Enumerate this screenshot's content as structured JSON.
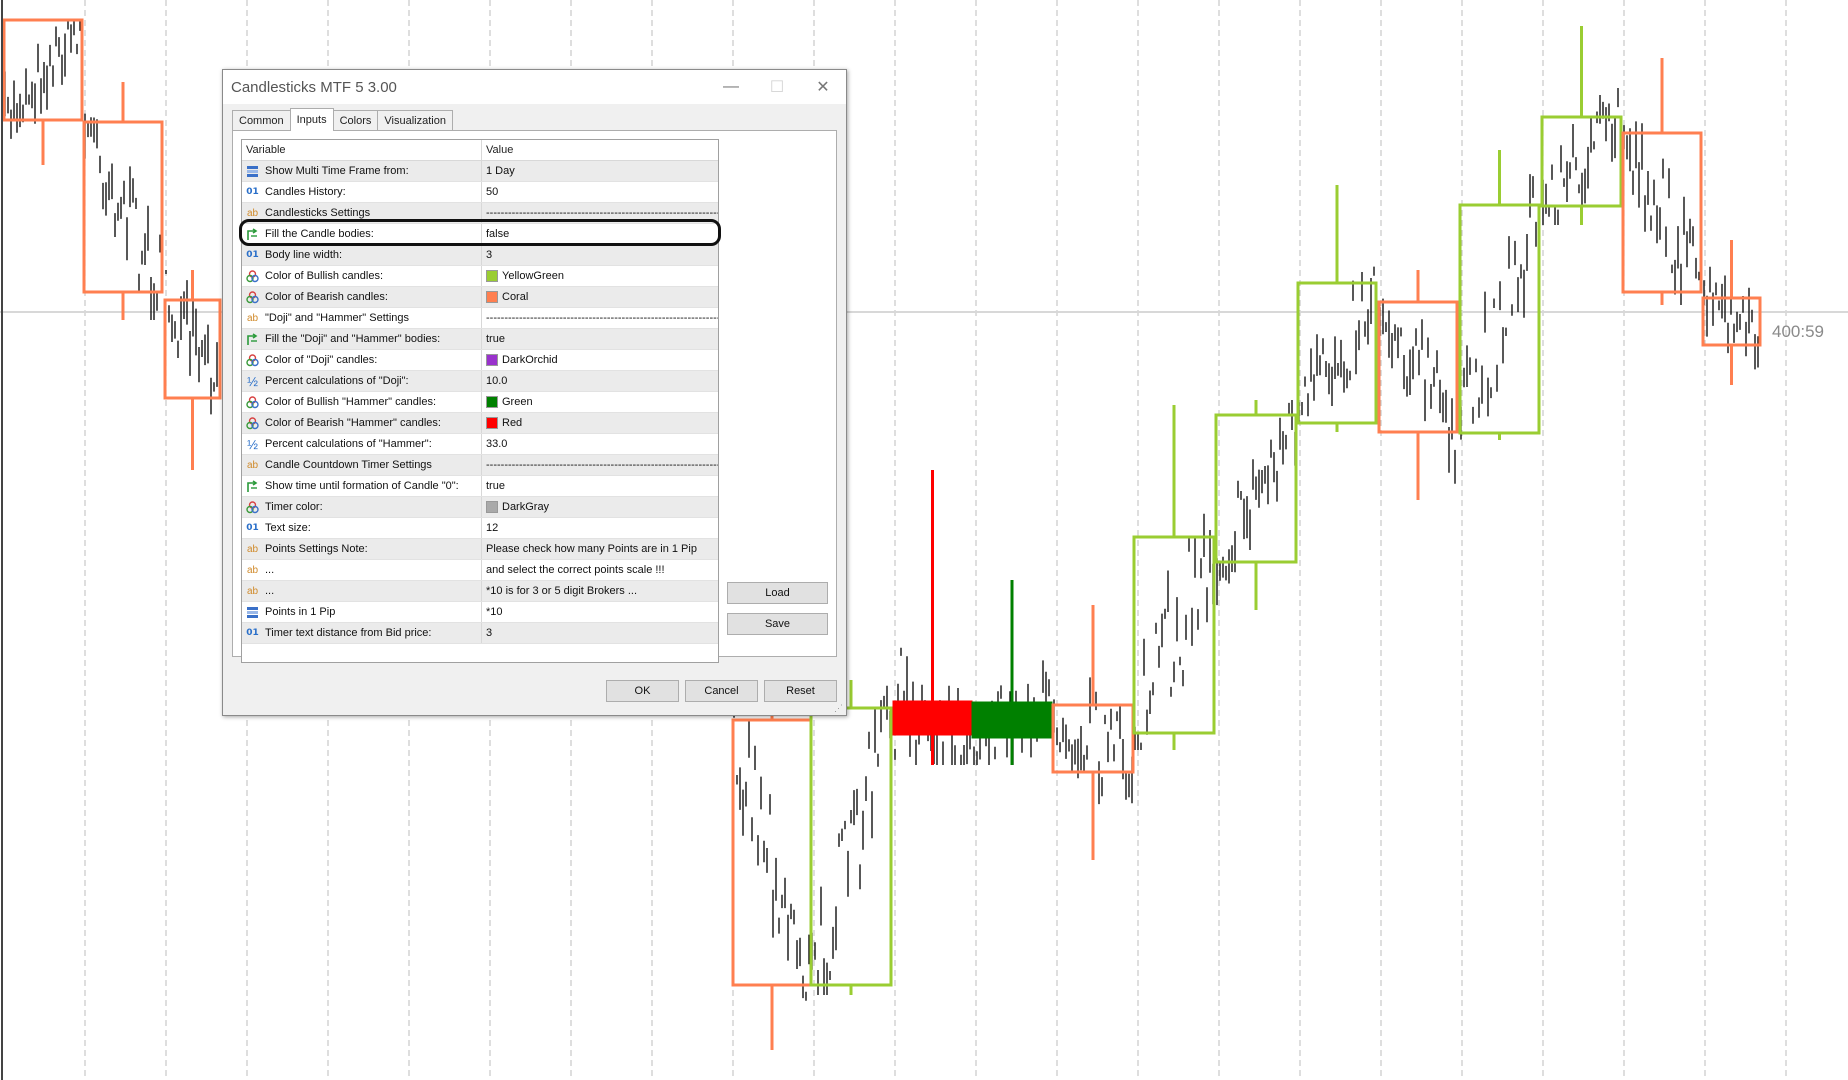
{
  "dialog": {
    "title": "Candlesticks MTF 5 3.00",
    "window_buttons": {
      "minimize": "—",
      "maximize": "☐",
      "close": "✕"
    },
    "tabs": [
      {
        "label": "Common",
        "active": false
      },
      {
        "label": "Inputs",
        "active": true
      },
      {
        "label": "Colors",
        "active": false
      },
      {
        "label": "Visualization",
        "active": false
      }
    ],
    "columns": {
      "variable": "Variable",
      "value": "Value"
    },
    "rows": [
      {
        "icon": "enum",
        "variable": "Show Multi Time Frame from:",
        "value": "1 Day"
      },
      {
        "icon": "int",
        "variable": "Candles History:",
        "value": "50"
      },
      {
        "icon": "string",
        "variable": "Candlesticks Settings",
        "value": "--------------------------------------------------------------------"
      },
      {
        "icon": "bool",
        "variable": "Fill the Candle bodies:",
        "value": "false"
      },
      {
        "icon": "int",
        "variable": "Body line width:",
        "value": "3"
      },
      {
        "icon": "color",
        "variable": "Color of Bullish candles:",
        "value": "YellowGreen",
        "swatch": "#9acd32"
      },
      {
        "icon": "color",
        "variable": "Color of Bearish candles:",
        "value": "Coral",
        "swatch": "#ff7f50"
      },
      {
        "icon": "string",
        "variable": "\"Doji\" and \"Hammer\" Settings",
        "value": "--------------------------------------------------------------------"
      },
      {
        "icon": "bool",
        "variable": "Fill the \"Doji\" and \"Hammer\" bodies:",
        "value": "true"
      },
      {
        "icon": "color",
        "variable": "Color of \"Doji\" candles:",
        "value": "DarkOrchid",
        "swatch": "#9932cc"
      },
      {
        "icon": "double",
        "variable": "Percent calculations of \"Doji\":",
        "value": "10.0"
      },
      {
        "icon": "color",
        "variable": "Color of Bullish \"Hammer\" candles:",
        "value": "Green",
        "swatch": "#008000"
      },
      {
        "icon": "color",
        "variable": "Color of Bearish \"Hammer\" candles:",
        "value": "Red",
        "swatch": "#ff0000"
      },
      {
        "icon": "double",
        "variable": "Percent calculations of \"Hammer\":",
        "value": "33.0"
      },
      {
        "icon": "string",
        "variable": "Candle Countdown Timer Settings",
        "value": "--------------------------------------------------------------------"
      },
      {
        "icon": "bool",
        "variable": "Show time until formation of Candle \"0\":",
        "value": "true"
      },
      {
        "icon": "color",
        "variable": "Timer color:",
        "value": "DarkGray",
        "swatch": "#a9a9a9"
      },
      {
        "icon": "int",
        "variable": "Text size:",
        "value": "12"
      },
      {
        "icon": "string",
        "variable": "Points Settings Note:",
        "value": "Please check how many Points are in 1 Pip"
      },
      {
        "icon": "string",
        "variable": "...",
        "value": "and select the correct points scale !!!"
      },
      {
        "icon": "string",
        "variable": "...",
        "value": "*10 is for 3 or 5 digit Brokers ..."
      },
      {
        "icon": "enum",
        "variable": "Points in 1 Pip",
        "value": "*10"
      },
      {
        "icon": "int",
        "variable": "Timer text distance from Bid price:",
        "value": "3"
      }
    ],
    "buttons": {
      "load": "Load",
      "save": "Save",
      "ok": "OK",
      "cancel": "Cancel",
      "reset": "Reset"
    }
  },
  "chart": {
    "timer_label": "400:59",
    "colors": {
      "bullish": "#9acd32",
      "bearish": "#ff7f50",
      "hammer_bull": "#008000",
      "hammer_bear": "#ff0000",
      "ticks": "#111111"
    }
  }
}
